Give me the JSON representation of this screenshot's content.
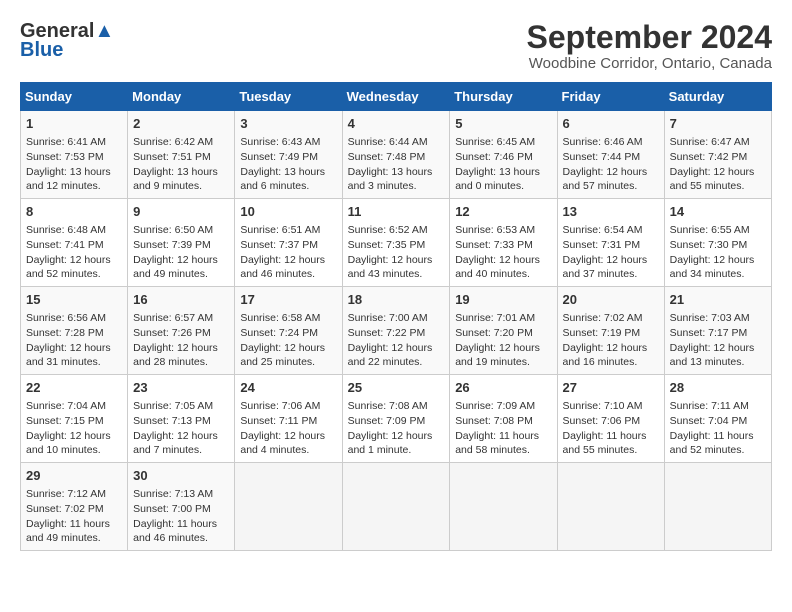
{
  "logo": {
    "line1": "General",
    "line2": "Blue"
  },
  "title": "September 2024",
  "subtitle": "Woodbine Corridor, Ontario, Canada",
  "headers": [
    "Sunday",
    "Monday",
    "Tuesday",
    "Wednesday",
    "Thursday",
    "Friday",
    "Saturday"
  ],
  "weeks": [
    [
      {
        "day": "1",
        "sunrise": "Sunrise: 6:41 AM",
        "sunset": "Sunset: 7:53 PM",
        "daylight": "Daylight: 13 hours and 12 minutes."
      },
      {
        "day": "2",
        "sunrise": "Sunrise: 6:42 AM",
        "sunset": "Sunset: 7:51 PM",
        "daylight": "Daylight: 13 hours and 9 minutes."
      },
      {
        "day": "3",
        "sunrise": "Sunrise: 6:43 AM",
        "sunset": "Sunset: 7:49 PM",
        "daylight": "Daylight: 13 hours and 6 minutes."
      },
      {
        "day": "4",
        "sunrise": "Sunrise: 6:44 AM",
        "sunset": "Sunset: 7:48 PM",
        "daylight": "Daylight: 13 hours and 3 minutes."
      },
      {
        "day": "5",
        "sunrise": "Sunrise: 6:45 AM",
        "sunset": "Sunset: 7:46 PM",
        "daylight": "Daylight: 13 hours and 0 minutes."
      },
      {
        "day": "6",
        "sunrise": "Sunrise: 6:46 AM",
        "sunset": "Sunset: 7:44 PM",
        "daylight": "Daylight: 12 hours and 57 minutes."
      },
      {
        "day": "7",
        "sunrise": "Sunrise: 6:47 AM",
        "sunset": "Sunset: 7:42 PM",
        "daylight": "Daylight: 12 hours and 55 minutes."
      }
    ],
    [
      {
        "day": "8",
        "sunrise": "Sunrise: 6:48 AM",
        "sunset": "Sunset: 7:41 PM",
        "daylight": "Daylight: 12 hours and 52 minutes."
      },
      {
        "day": "9",
        "sunrise": "Sunrise: 6:50 AM",
        "sunset": "Sunset: 7:39 PM",
        "daylight": "Daylight: 12 hours and 49 minutes."
      },
      {
        "day": "10",
        "sunrise": "Sunrise: 6:51 AM",
        "sunset": "Sunset: 7:37 PM",
        "daylight": "Daylight: 12 hours and 46 minutes."
      },
      {
        "day": "11",
        "sunrise": "Sunrise: 6:52 AM",
        "sunset": "Sunset: 7:35 PM",
        "daylight": "Daylight: 12 hours and 43 minutes."
      },
      {
        "day": "12",
        "sunrise": "Sunrise: 6:53 AM",
        "sunset": "Sunset: 7:33 PM",
        "daylight": "Daylight: 12 hours and 40 minutes."
      },
      {
        "day": "13",
        "sunrise": "Sunrise: 6:54 AM",
        "sunset": "Sunset: 7:31 PM",
        "daylight": "Daylight: 12 hours and 37 minutes."
      },
      {
        "day": "14",
        "sunrise": "Sunrise: 6:55 AM",
        "sunset": "Sunset: 7:30 PM",
        "daylight": "Daylight: 12 hours and 34 minutes."
      }
    ],
    [
      {
        "day": "15",
        "sunrise": "Sunrise: 6:56 AM",
        "sunset": "Sunset: 7:28 PM",
        "daylight": "Daylight: 12 hours and 31 minutes."
      },
      {
        "day": "16",
        "sunrise": "Sunrise: 6:57 AM",
        "sunset": "Sunset: 7:26 PM",
        "daylight": "Daylight: 12 hours and 28 minutes."
      },
      {
        "day": "17",
        "sunrise": "Sunrise: 6:58 AM",
        "sunset": "Sunset: 7:24 PM",
        "daylight": "Daylight: 12 hours and 25 minutes."
      },
      {
        "day": "18",
        "sunrise": "Sunrise: 7:00 AM",
        "sunset": "Sunset: 7:22 PM",
        "daylight": "Daylight: 12 hours and 22 minutes."
      },
      {
        "day": "19",
        "sunrise": "Sunrise: 7:01 AM",
        "sunset": "Sunset: 7:20 PM",
        "daylight": "Daylight: 12 hours and 19 minutes."
      },
      {
        "day": "20",
        "sunrise": "Sunrise: 7:02 AM",
        "sunset": "Sunset: 7:19 PM",
        "daylight": "Daylight: 12 hours and 16 minutes."
      },
      {
        "day": "21",
        "sunrise": "Sunrise: 7:03 AM",
        "sunset": "Sunset: 7:17 PM",
        "daylight": "Daylight: 12 hours and 13 minutes."
      }
    ],
    [
      {
        "day": "22",
        "sunrise": "Sunrise: 7:04 AM",
        "sunset": "Sunset: 7:15 PM",
        "daylight": "Daylight: 12 hours and 10 minutes."
      },
      {
        "day": "23",
        "sunrise": "Sunrise: 7:05 AM",
        "sunset": "Sunset: 7:13 PM",
        "daylight": "Daylight: 12 hours and 7 minutes."
      },
      {
        "day": "24",
        "sunrise": "Sunrise: 7:06 AM",
        "sunset": "Sunset: 7:11 PM",
        "daylight": "Daylight: 12 hours and 4 minutes."
      },
      {
        "day": "25",
        "sunrise": "Sunrise: 7:08 AM",
        "sunset": "Sunset: 7:09 PM",
        "daylight": "Daylight: 12 hours and 1 minute."
      },
      {
        "day": "26",
        "sunrise": "Sunrise: 7:09 AM",
        "sunset": "Sunset: 7:08 PM",
        "daylight": "Daylight: 11 hours and 58 minutes."
      },
      {
        "day": "27",
        "sunrise": "Sunrise: 7:10 AM",
        "sunset": "Sunset: 7:06 PM",
        "daylight": "Daylight: 11 hours and 55 minutes."
      },
      {
        "day": "28",
        "sunrise": "Sunrise: 7:11 AM",
        "sunset": "Sunset: 7:04 PM",
        "daylight": "Daylight: 11 hours and 52 minutes."
      }
    ],
    [
      {
        "day": "29",
        "sunrise": "Sunrise: 7:12 AM",
        "sunset": "Sunset: 7:02 PM",
        "daylight": "Daylight: 11 hours and 49 minutes."
      },
      {
        "day": "30",
        "sunrise": "Sunrise: 7:13 AM",
        "sunset": "Sunset: 7:00 PM",
        "daylight": "Daylight: 11 hours and 46 minutes."
      },
      null,
      null,
      null,
      null,
      null
    ]
  ]
}
